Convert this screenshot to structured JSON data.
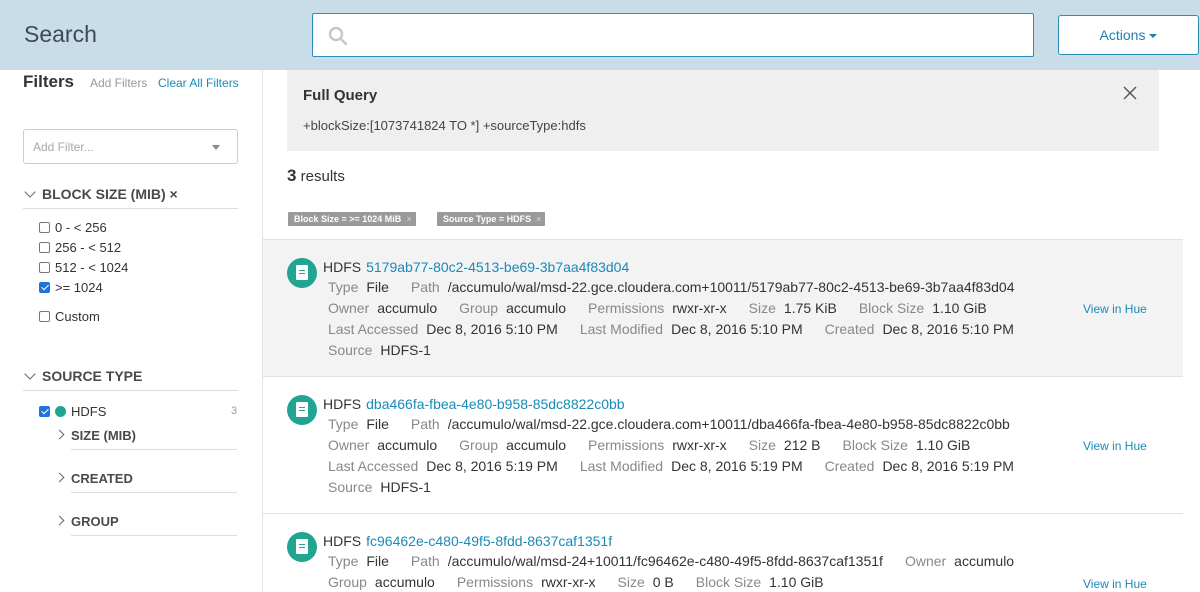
{
  "header": {
    "title": "Search",
    "search_placeholder": "",
    "actions_label": "Actions"
  },
  "sidebar": {
    "title": "Filters",
    "add_filters": "Add Filters",
    "clear_all": "Clear All Filters",
    "add_filter_placeholder": "Add Filter...",
    "block_size": {
      "heading": "BLOCK SIZE (MIB) ×",
      "options": [
        {
          "label": "0 - < 256",
          "checked": false
        },
        {
          "label": "256 - < 512",
          "checked": false
        },
        {
          "label": "512 - < 1024",
          "checked": false
        },
        {
          "label": ">= 1024",
          "checked": true
        },
        {
          "label": "Custom",
          "checked": false
        }
      ]
    },
    "source_type": {
      "heading": "SOURCE TYPE",
      "item": {
        "label": "HDFS",
        "count": "3",
        "checked": true
      },
      "subsections": [
        "SIZE (MIB)",
        "CREATED",
        "GROUP"
      ]
    }
  },
  "full_query": {
    "title": "Full Query",
    "text": "+blockSize:[1073741824 TO *] +sourceType:hdfs"
  },
  "results_summary": {
    "count": "3",
    "label": "results"
  },
  "active_tags": [
    {
      "label": "Block Size = >= 1024 MiB",
      "close": "×"
    },
    {
      "label": "Source Type = HDFS",
      "close": "×"
    }
  ],
  "labels": {
    "type": "Type",
    "path": "Path",
    "owner": "Owner",
    "group": "Group",
    "permissions": "Permissions",
    "size": "Size",
    "block_size": "Block Size",
    "last_accessed": "Last Accessed",
    "last_modified": "Last Modified",
    "created": "Created",
    "source": "Source",
    "view_in_hue": "View in Hue"
  },
  "results": [
    {
      "source": "HDFS",
      "id": "5179ab77-80c2-4513-be69-3b7aa4f83d04",
      "type": "File",
      "path": "/accumulo/wal/msd-22.gce.cloudera.com+10011/5179ab77-80c2-4513-be69-3b7aa4f83d04",
      "owner": "accumulo",
      "group": "accumulo",
      "permissions": "rwxr-xr-x",
      "size": "1.75 KiB",
      "block_size": "1.10 GiB",
      "last_accessed": "Dec 8, 2016 5:10 PM",
      "last_modified": "Dec 8, 2016 5:10 PM",
      "created": "Dec 8, 2016 5:10 PM",
      "source_name": "HDFS-1"
    },
    {
      "source": "HDFS",
      "id": "dba466fa-fbea-4e80-b958-85dc8822c0bb",
      "type": "File",
      "path": "/accumulo/wal/msd-22.gce.cloudera.com+10011/dba466fa-fbea-4e80-b958-85dc8822c0bb",
      "owner": "accumulo",
      "group": "accumulo",
      "permissions": "rwxr-xr-x",
      "size": "212 B",
      "block_size": "1.10 GiB",
      "last_accessed": "Dec 8, 2016 5:19 PM",
      "last_modified": "Dec 8, 2016 5:19 PM",
      "created": "Dec 8, 2016 5:19 PM",
      "source_name": "HDFS-1"
    },
    {
      "source": "HDFS",
      "id": "fc96462e-c480-49f5-8fdd-8637caf1351f",
      "type": "File",
      "path": "/accumulo/wal/msd-24+10011/fc96462e-c480-49f5-8fdd-8637caf1351f",
      "owner": "accumulo",
      "group": "accumulo",
      "permissions": "rwxr-xr-x",
      "size": "0 B",
      "block_size": "1.10 GiB"
    }
  ],
  "colors": {
    "accent": "#1a8ab8",
    "header_bg": "#c9dde9",
    "icon_teal": "#21a592",
    "checkbox_blue": "#1e74d9"
  }
}
